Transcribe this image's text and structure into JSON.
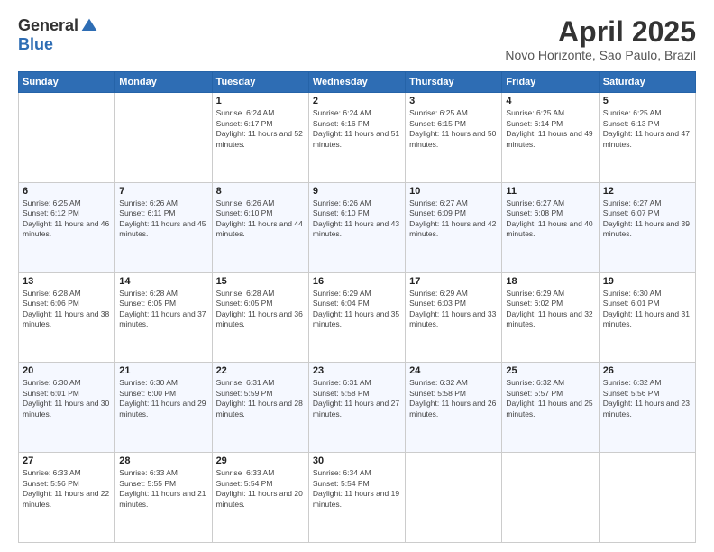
{
  "header": {
    "logo_general": "General",
    "logo_blue": "Blue",
    "title": "April 2025",
    "location": "Novo Horizonte, Sao Paulo, Brazil"
  },
  "days_of_week": [
    "Sunday",
    "Monday",
    "Tuesday",
    "Wednesday",
    "Thursday",
    "Friday",
    "Saturday"
  ],
  "weeks": [
    [
      {
        "day": "",
        "info": ""
      },
      {
        "day": "",
        "info": ""
      },
      {
        "day": "1",
        "info": "Sunrise: 6:24 AM\nSunset: 6:17 PM\nDaylight: 11 hours and 52 minutes."
      },
      {
        "day": "2",
        "info": "Sunrise: 6:24 AM\nSunset: 6:16 PM\nDaylight: 11 hours and 51 minutes."
      },
      {
        "day": "3",
        "info": "Sunrise: 6:25 AM\nSunset: 6:15 PM\nDaylight: 11 hours and 50 minutes."
      },
      {
        "day": "4",
        "info": "Sunrise: 6:25 AM\nSunset: 6:14 PM\nDaylight: 11 hours and 49 minutes."
      },
      {
        "day": "5",
        "info": "Sunrise: 6:25 AM\nSunset: 6:13 PM\nDaylight: 11 hours and 47 minutes."
      }
    ],
    [
      {
        "day": "6",
        "info": "Sunrise: 6:25 AM\nSunset: 6:12 PM\nDaylight: 11 hours and 46 minutes."
      },
      {
        "day": "7",
        "info": "Sunrise: 6:26 AM\nSunset: 6:11 PM\nDaylight: 11 hours and 45 minutes."
      },
      {
        "day": "8",
        "info": "Sunrise: 6:26 AM\nSunset: 6:10 PM\nDaylight: 11 hours and 44 minutes."
      },
      {
        "day": "9",
        "info": "Sunrise: 6:26 AM\nSunset: 6:10 PM\nDaylight: 11 hours and 43 minutes."
      },
      {
        "day": "10",
        "info": "Sunrise: 6:27 AM\nSunset: 6:09 PM\nDaylight: 11 hours and 42 minutes."
      },
      {
        "day": "11",
        "info": "Sunrise: 6:27 AM\nSunset: 6:08 PM\nDaylight: 11 hours and 40 minutes."
      },
      {
        "day": "12",
        "info": "Sunrise: 6:27 AM\nSunset: 6:07 PM\nDaylight: 11 hours and 39 minutes."
      }
    ],
    [
      {
        "day": "13",
        "info": "Sunrise: 6:28 AM\nSunset: 6:06 PM\nDaylight: 11 hours and 38 minutes."
      },
      {
        "day": "14",
        "info": "Sunrise: 6:28 AM\nSunset: 6:05 PM\nDaylight: 11 hours and 37 minutes."
      },
      {
        "day": "15",
        "info": "Sunrise: 6:28 AM\nSunset: 6:05 PM\nDaylight: 11 hours and 36 minutes."
      },
      {
        "day": "16",
        "info": "Sunrise: 6:29 AM\nSunset: 6:04 PM\nDaylight: 11 hours and 35 minutes."
      },
      {
        "day": "17",
        "info": "Sunrise: 6:29 AM\nSunset: 6:03 PM\nDaylight: 11 hours and 33 minutes."
      },
      {
        "day": "18",
        "info": "Sunrise: 6:29 AM\nSunset: 6:02 PM\nDaylight: 11 hours and 32 minutes."
      },
      {
        "day": "19",
        "info": "Sunrise: 6:30 AM\nSunset: 6:01 PM\nDaylight: 11 hours and 31 minutes."
      }
    ],
    [
      {
        "day": "20",
        "info": "Sunrise: 6:30 AM\nSunset: 6:01 PM\nDaylight: 11 hours and 30 minutes."
      },
      {
        "day": "21",
        "info": "Sunrise: 6:30 AM\nSunset: 6:00 PM\nDaylight: 11 hours and 29 minutes."
      },
      {
        "day": "22",
        "info": "Sunrise: 6:31 AM\nSunset: 5:59 PM\nDaylight: 11 hours and 28 minutes."
      },
      {
        "day": "23",
        "info": "Sunrise: 6:31 AM\nSunset: 5:58 PM\nDaylight: 11 hours and 27 minutes."
      },
      {
        "day": "24",
        "info": "Sunrise: 6:32 AM\nSunset: 5:58 PM\nDaylight: 11 hours and 26 minutes."
      },
      {
        "day": "25",
        "info": "Sunrise: 6:32 AM\nSunset: 5:57 PM\nDaylight: 11 hours and 25 minutes."
      },
      {
        "day": "26",
        "info": "Sunrise: 6:32 AM\nSunset: 5:56 PM\nDaylight: 11 hours and 23 minutes."
      }
    ],
    [
      {
        "day": "27",
        "info": "Sunrise: 6:33 AM\nSunset: 5:56 PM\nDaylight: 11 hours and 22 minutes."
      },
      {
        "day": "28",
        "info": "Sunrise: 6:33 AM\nSunset: 5:55 PM\nDaylight: 11 hours and 21 minutes."
      },
      {
        "day": "29",
        "info": "Sunrise: 6:33 AM\nSunset: 5:54 PM\nDaylight: 11 hours and 20 minutes."
      },
      {
        "day": "30",
        "info": "Sunrise: 6:34 AM\nSunset: 5:54 PM\nDaylight: 11 hours and 19 minutes."
      },
      {
        "day": "",
        "info": ""
      },
      {
        "day": "",
        "info": ""
      },
      {
        "day": "",
        "info": ""
      }
    ]
  ]
}
